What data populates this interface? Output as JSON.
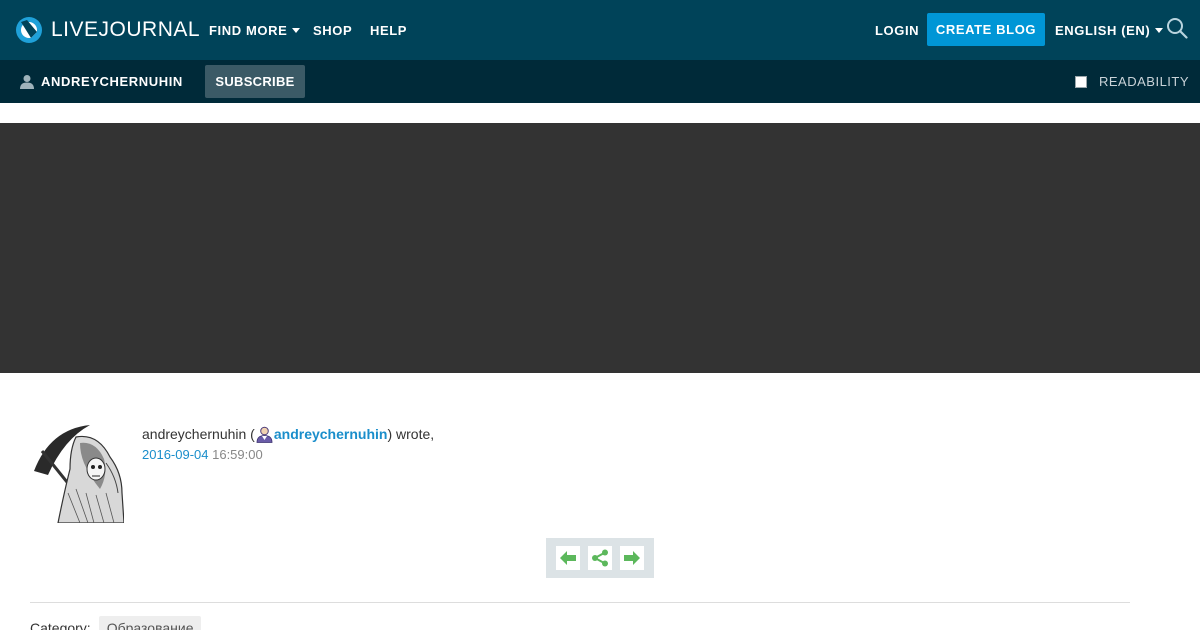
{
  "topbar": {
    "logo_text": "LIVEJOURNAL",
    "find_more": "FIND MORE",
    "shop": "SHOP",
    "help": "HELP",
    "login": "LOGIN",
    "create_blog": "CREATE BLOG",
    "language": "ENGLISH (EN)"
  },
  "subbar": {
    "username": "ANDREYCHERNUHIN",
    "subscribe": "SUBSCRIBE",
    "readability": "READABILITY"
  },
  "entry": {
    "author": "andreychernuhin",
    "open_paren": " (",
    "ljuser": "andreychernuhin",
    "wrote": ") wrote,",
    "date": "2016-09-04",
    "time": " 16:59:00",
    "category_label": "Category:",
    "category_tag": "Образование"
  },
  "colors": {
    "topbar": "#004359",
    "subbar": "#002a39",
    "accent": "#0096d6",
    "link": "#1a8ecb",
    "banner": "#333333",
    "tool_green": "#5cb85c"
  }
}
